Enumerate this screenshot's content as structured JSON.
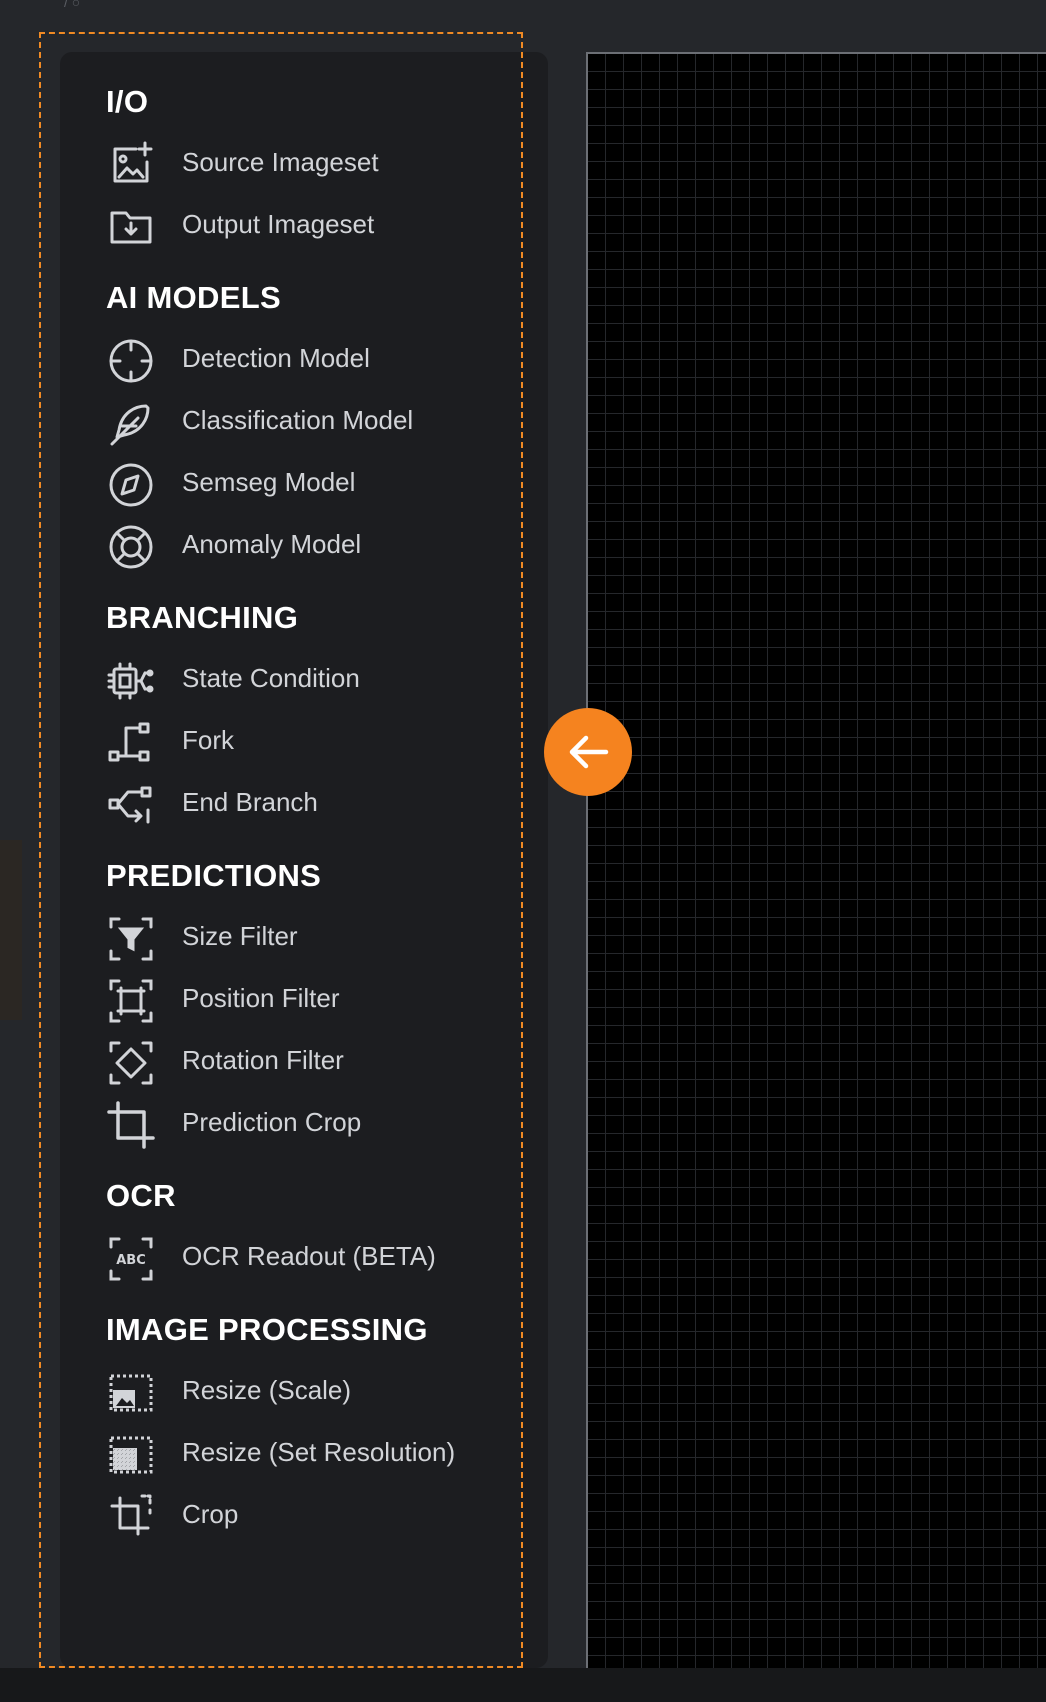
{
  "top": {
    "crumb": "/ ○"
  },
  "sidebar": {
    "sections": [
      {
        "title": "I/O",
        "items": [
          {
            "label": "Source Imageset",
            "icon": "image-add-icon"
          },
          {
            "label": "Output Imageset",
            "icon": "folder-download-icon"
          }
        ]
      },
      {
        "title": "AI MODELS",
        "items": [
          {
            "label": "Detection Model",
            "icon": "crosshair-icon"
          },
          {
            "label": "Classification Model",
            "icon": "feather-icon"
          },
          {
            "label": "Semseg Model",
            "icon": "compass-icon"
          },
          {
            "label": "Anomaly Model",
            "icon": "lifebuoy-icon"
          }
        ]
      },
      {
        "title": "BRANCHING",
        "items": [
          {
            "label": "State Condition",
            "icon": "chip-condition-icon"
          },
          {
            "label": "Fork",
            "icon": "fork-icon"
          },
          {
            "label": "End Branch",
            "icon": "merge-icon"
          }
        ]
      },
      {
        "title": "PREDICTIONS",
        "items": [
          {
            "label": "Size Filter",
            "icon": "filter-frame-icon"
          },
          {
            "label": "Position Filter",
            "icon": "position-frame-icon"
          },
          {
            "label": "Rotation Filter",
            "icon": "rotation-frame-icon"
          },
          {
            "label": "Prediction Crop",
            "icon": "crop-icon"
          }
        ]
      },
      {
        "title": "OCR",
        "items": [
          {
            "label": "OCR Readout (BETA)",
            "icon": "abc-frame-icon",
            "icon_text": "ABC"
          }
        ]
      },
      {
        "title": "IMAGE PROCESSING",
        "items": [
          {
            "label": "Resize (Scale)",
            "icon": "resize-scale-icon"
          },
          {
            "label": "Resize (Set Resolution)",
            "icon": "resize-resolution-icon"
          },
          {
            "label": "Crop",
            "icon": "crop-dashed-icon"
          }
        ]
      }
    ]
  },
  "colors": {
    "accent": "#f5831f",
    "panel_bg": "#1c1d20",
    "page_bg": "#25272b",
    "text": "#d2d4d8",
    "heading": "#ffffff",
    "canvas_bg": "#000000"
  }
}
